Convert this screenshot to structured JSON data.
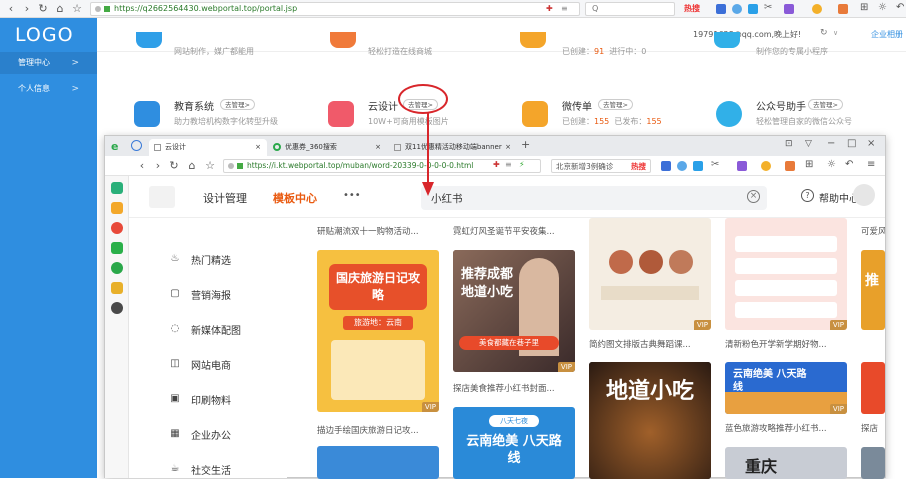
{
  "outer_browser": {
    "url": "https://q2662564430.webportal.top/portal.jsp",
    "search_placeholder": "Q",
    "hot_label": "热搜"
  },
  "sidebar": {
    "logo": "LOGO",
    "items": [
      {
        "label": "管理中心",
        "chev": ">"
      },
      {
        "label": "个人信息",
        "chev": ">"
      }
    ]
  },
  "header": {
    "user": "19791628@qq.com,晚上好!",
    "enterprise": "企业相册",
    "chev": "∨"
  },
  "top_cards": [
    {
      "sub": "网站制作，媒广都能用"
    },
    {
      "sub": "轻松打造在线商城"
    },
    {
      "sub_prefix": "已创建：",
      "created": "91",
      "sub_mid": "进行中：",
      "running": "0"
    },
    {
      "sub": "制作您的专属小程序"
    }
  ],
  "cards": [
    {
      "title": "教育系统",
      "tag": "去管理>",
      "sub": "助力教培机构数字化转型升级"
    },
    {
      "title": "云设计",
      "tag": "去管理>",
      "sub": "10W+可商用模板图片"
    },
    {
      "title": "微传单",
      "tag": "去管理>",
      "sub_prefix": "已创建：",
      "created": "155",
      "sub_mid": "已发布：",
      "published": "155"
    },
    {
      "title": "公众号助手",
      "tag": "去管理>",
      "sub": "轻松管理自家的微信公众号"
    }
  ],
  "inner_browser": {
    "tabs": [
      {
        "label": "云设计",
        "close": "×"
      },
      {
        "label": "优惠券_360搜索",
        "close": "×"
      },
      {
        "label": "双11优惠精活动移动端banner",
        "close": "×"
      }
    ],
    "new_tab": "+",
    "url": "https://i.kt.webportal.top/muban/word-20339-0-0-0-0-0.html",
    "search_text": "北京新增3例确诊",
    "hot_label": "热搜",
    "win_controls": [
      "−",
      "□",
      "×"
    ]
  },
  "site": {
    "nav": [
      {
        "label": "设计管理"
      },
      {
        "label": "模板中心"
      },
      {
        "label": "•••"
      }
    ],
    "search_value": "小红书",
    "help": "帮助中心"
  },
  "categories": [
    {
      "icon": "flame-icon",
      "glyph": "♨",
      "label": "热门精选"
    },
    {
      "icon": "poster-icon",
      "glyph": "▢",
      "label": "营销海报"
    },
    {
      "icon": "chat-icon",
      "glyph": "◌",
      "label": "新媒体配图"
    },
    {
      "icon": "shop-icon",
      "glyph": "◫",
      "label": "网站电商"
    },
    {
      "icon": "print-icon",
      "glyph": "▣",
      "label": "印刷物料"
    },
    {
      "icon": "office-icon",
      "glyph": "▦",
      "label": "企业办公"
    },
    {
      "icon": "social-icon",
      "glyph": "☕",
      "label": "社交生活"
    }
  ],
  "templates": {
    "top_captions": [
      "研贴潮流双十一购物活动...",
      "霓虹灯风圣诞节平安夜集...",
      "",
      "可爱风"
    ],
    "col1": {
      "caption": "描边手绘国庆旅游日记攻...",
      "title": "国庆旅游日记攻略",
      "sub": "旅游地：云南",
      "vip": "VIP"
    },
    "col2": {
      "caption": "探店美食推荐小红书封面...",
      "title": "推荐成都地道小吃",
      "sub": "美食都藏在巷子里",
      "vip": "VIP",
      "title2": "云南绝美 八天路线",
      "tag2": "八天七夜"
    },
    "col3": {
      "caption": "简约图文排版古典舞蹈课...",
      "vip": "VIP",
      "title": "地道小吃"
    },
    "col4": {
      "caption": "清新粉色开学新学期好物...",
      "vip": "VIP",
      "caption2": "蓝色旅游攻略推荐小红书...",
      "title2": "云南绝美 八天路线",
      "title3": "重庆"
    },
    "col5": {
      "caption": "探店",
      "title": "推"
    }
  },
  "colors": {
    "sidebar": "#2f8ee0",
    "accent": "#e95a10",
    "vip": "#c89040",
    "annotation": "#d8262b"
  }
}
